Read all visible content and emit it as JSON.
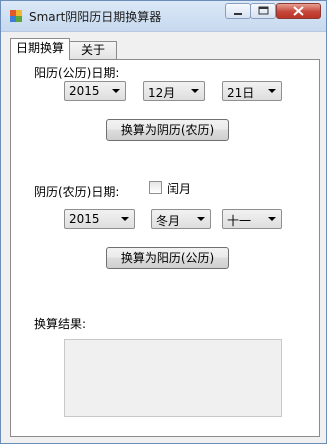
{
  "window": {
    "title": "Smart阴阳历日期换算器"
  },
  "tabs": [
    {
      "label": "日期换算",
      "active": true
    },
    {
      "label": "关于",
      "active": false
    }
  ],
  "solar_to_lunar": {
    "label": "阳历(公历)日期:",
    "year": "2015",
    "month": "12月",
    "day": "21日",
    "button_label": "换算为阴历(农历)"
  },
  "lunar_to_solar": {
    "label": "阴历(农历)日期:",
    "leap_month_label": "闰月",
    "leap_month_checked": false,
    "year": "2015",
    "month": "冬月",
    "day": "十一",
    "button_label": "换算为阳历(公历)"
  },
  "result": {
    "label": "换算结果:",
    "value": ""
  },
  "colors": {
    "window_bg": "#f0f0f0",
    "panel_bg": "#ffffff",
    "close_button": "#c5463a"
  }
}
